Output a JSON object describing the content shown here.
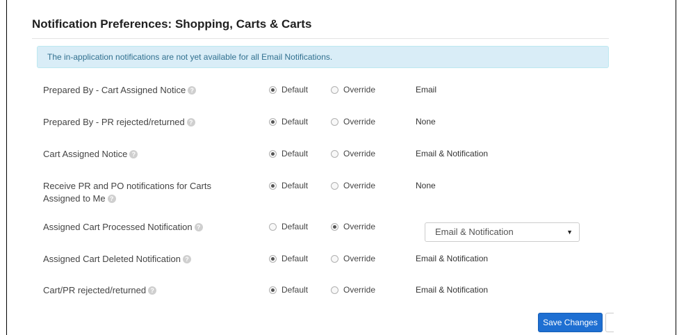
{
  "page": {
    "title": "Notification Preferences:  Shopping, Carts & Carts",
    "alert": "The in-application notifications are not yet available for all Email Notifications.",
    "help_glyph": "?"
  },
  "options": {
    "default_label": "Default",
    "override_label": "Override"
  },
  "rows": [
    {
      "label": "Prepared By - Cart Assigned Notice",
      "selected": "Default",
      "value": "Email"
    },
    {
      "label": "Prepared By - PR rejected/returned",
      "selected": "Default",
      "value": "None"
    },
    {
      "label": "Cart Assigned Notice",
      "selected": "Default",
      "value": "Email & Notification"
    },
    {
      "label": "Receive PR and PO notifications for Carts Assigned to Me",
      "selected": "Default",
      "value": "None"
    },
    {
      "label": "Assigned Cart Processed Notification",
      "selected": "Override",
      "select_value": "Email & Notification"
    },
    {
      "label": "Assigned Cart Deleted Notification",
      "selected": "Default",
      "value": "Email & Notification"
    },
    {
      "label": "Cart/PR rejected/returned",
      "selected": "Default",
      "value": "Email & Notification"
    }
  ],
  "actions": {
    "save_label": "Save Changes"
  },
  "icons": {
    "help": "help-circle-icon",
    "dropdown": "caret-down-icon"
  },
  "colors": {
    "alert_bg": "#d9edf7",
    "alert_text": "#31708f",
    "primary_button": "#1e6fd2"
  }
}
